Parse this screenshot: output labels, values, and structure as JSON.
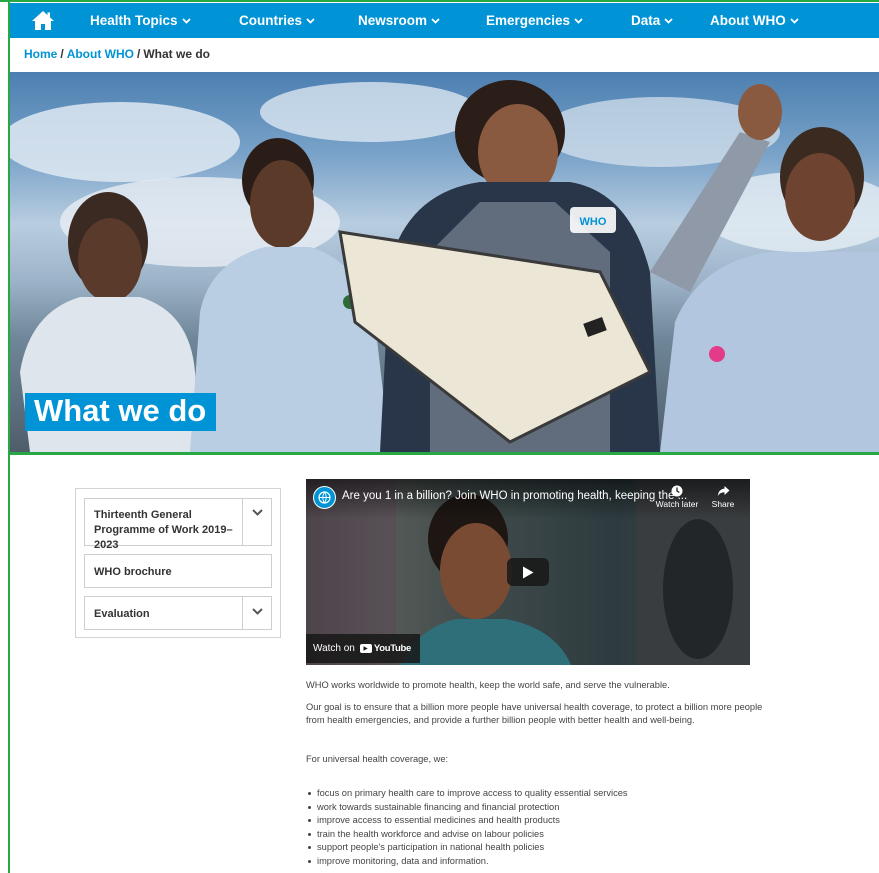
{
  "nav": {
    "home_icon": "home-icon",
    "items": [
      {
        "label": "Health Topics"
      },
      {
        "label": "Countries"
      },
      {
        "label": "Newsroom"
      },
      {
        "label": "Emergencies"
      },
      {
        "label": "Data"
      },
      {
        "label": "About WHO"
      }
    ]
  },
  "breadcrumb": {
    "home": "Home",
    "separator": "/",
    "parent": "About WHO",
    "current": "What we do"
  },
  "hero": {
    "title": "What we do",
    "vest_text": "WHO"
  },
  "sidebar": {
    "items": [
      {
        "label": "Thirteenth General Programme of Work 2019–2023",
        "expandable": true
      },
      {
        "label": "WHO brochure",
        "expandable": false
      },
      {
        "label": "Evaluation",
        "expandable": true
      }
    ]
  },
  "video": {
    "title": "Are you 1 in a billion? Join WHO in promoting health, keeping the ...",
    "watch_later": "Watch later",
    "share": "Share",
    "watch_on": "Watch on",
    "youtube": "YouTube"
  },
  "content": {
    "intro": "WHO works worldwide to promote health, keep the world safe, and serve the vulnerable.",
    "goal": "Our goal is to ensure that a billion more people have universal health coverage, to protect a billion more people from health emergencies, and provide a further billion people with better health and well-being.",
    "uhc_heading": "For universal health coverage, we:",
    "bullets": [
      "focus on primary health care to improve access to quality essential services",
      "work towards sustainable financing and financial protection",
      "improve access to essential medicines and health products",
      "train the health workforce and advise on labour policies",
      "support people's participation in national health policies",
      "improve monitoring, data and information."
    ]
  },
  "colors": {
    "brand_blue": "#0093d5",
    "frame_green": "#28a745",
    "text": "#333333"
  }
}
